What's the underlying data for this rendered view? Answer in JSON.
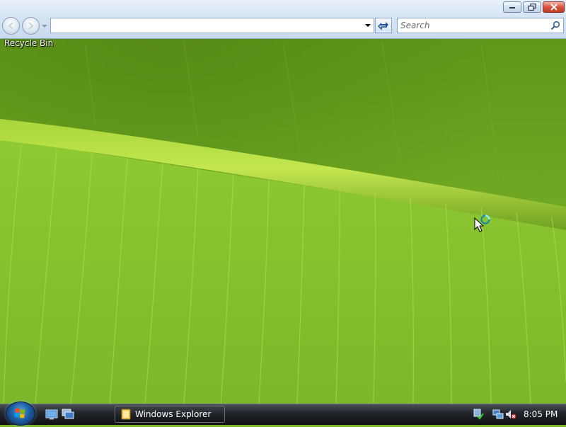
{
  "explorer": {
    "address_value": "",
    "search_placeholder": "Search"
  },
  "desktop": {
    "icons": [
      {
        "label": "Recycle Bin"
      }
    ]
  },
  "taskbar": {
    "items": [
      {
        "label": "Windows Explorer",
        "icon": "folder-icon"
      }
    ],
    "quick_launch": [
      "show-desktop-icon",
      "switch-windows-icon"
    ],
    "tray_icons": [
      "windows-defender-icon",
      "network-icon",
      "volume-muted-icon"
    ],
    "clock": "8:05 PM"
  },
  "cursor": "busy-cursor"
}
